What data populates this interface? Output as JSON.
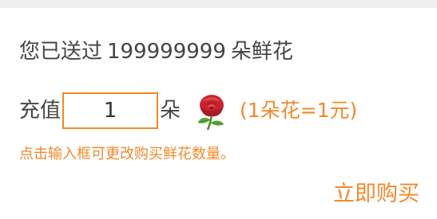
{
  "sent": {
    "prefix": "您已送过",
    "count": "199999999",
    "suffix": "朵鲜花"
  },
  "recharge": {
    "label": "充值",
    "quantity_value": "1",
    "unit": "朵",
    "flower_icon": "rose-icon",
    "rate_text": "(1朵花=1元)"
  },
  "hint": "点击输入框可更改购买鲜花数量。",
  "buy_button": "立即购买",
  "colors": {
    "accent": "#f0892a",
    "text": "#444444",
    "topbar": "#efefef"
  }
}
